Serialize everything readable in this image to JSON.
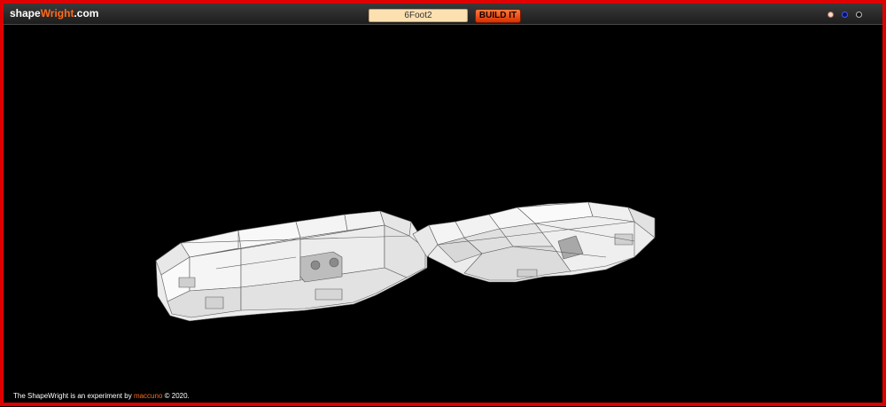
{
  "header": {
    "logo_part1": "shape",
    "logo_part2": "Wright",
    "logo_part3": ".com",
    "shape_input_value": "6Foot2",
    "build_button_label": "BUILD IT",
    "theme_dots": [
      {
        "name": "light-theme-dot",
        "color": "#ffd9c8"
      },
      {
        "name": "blue-theme-dot",
        "color": "#10105a"
      },
      {
        "name": "dark-theme-dot",
        "color": "#101010"
      }
    ]
  },
  "viewport": {
    "model_description": "wireframe spaceship model"
  },
  "footer": {
    "text_before": "The ShapeWright is an experiment by",
    "maker": "maccuno",
    "text_after": "© 2020."
  },
  "colors": {
    "frame": "#e00000",
    "accent": "#ff6a1a",
    "background": "#000000",
    "input_bg": "#fde0b0"
  }
}
